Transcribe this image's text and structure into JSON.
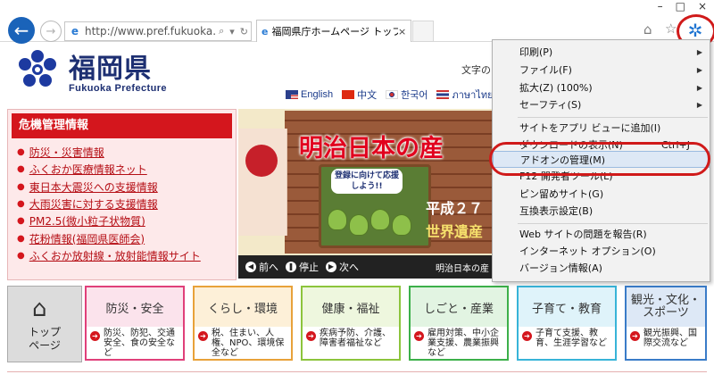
{
  "browser": {
    "address_url": "http://www.pref.fukuoka....",
    "tab_title": "福岡県庁ホームページ トップ...",
    "tab_close": "×"
  },
  "header": {
    "logo_text": "福岡県",
    "logo_subtitle": "Fukuoka Prefecture",
    "font_size_label": "文字の",
    "languages": [
      {
        "label": "English"
      },
      {
        "label": "中文"
      },
      {
        "label": "한국어"
      },
      {
        "label": "ภาษาไทย"
      }
    ]
  },
  "crisis": {
    "title": "危機管理情報",
    "links": [
      "防災・災害情報",
      "ふくおか医療情報ネット",
      "東日本大震災への支援情報",
      "大雨災害に対する支援情報",
      "PM2.5(微小粒子状物質)",
      "花粉情報(福岡県医師会)",
      "ふくおか放射線・放射能情報サイト"
    ]
  },
  "banner": {
    "title": "明治日本の産",
    "board_text": "登録に向けて応援しよう!!",
    "heisei_text": "平成２７",
    "isan_text": "世界遺産",
    "prev_label": "前へ",
    "stop_label": "停止",
    "next_label": "次へ",
    "caption": "明治日本の産"
  },
  "tiles": {
    "home": [
      "トップ",
      "ページ"
    ],
    "items": [
      {
        "title": "防災・安全",
        "desc": "防災、防犯、交通安全、食の安全など",
        "color": "#e0407a",
        "bg": "#fbe3ec"
      },
      {
        "title": "くらし・環境",
        "desc": "税、住まい、人権、NPO、環境保全など",
        "color": "#e8a23a",
        "bg": "#fdf0d8"
      },
      {
        "title": "健康・福祉",
        "desc": "疾病予防、介護、障害者福祉など",
        "color": "#8cc43c",
        "bg": "#eef7de"
      },
      {
        "title": "しごと・産業",
        "desc": "雇用対策、中小企業支援、農業振興など",
        "color": "#3cb04a",
        "bg": "#e2f4e2"
      },
      {
        "title": "子育て・教育",
        "desc": "子育て支援、教育、生涯学習など",
        "color": "#38b4d8",
        "bg": "#dff3fa"
      },
      {
        "title": "観光・文化・スポーツ",
        "desc": "観光振興、国際交流など",
        "color": "#3a7cc8",
        "bg": "#dde8f6"
      }
    ]
  },
  "menu": {
    "items": [
      {
        "label": "印刷(P)",
        "submenu": true
      },
      {
        "label": "ファイル(F)",
        "submenu": true
      },
      {
        "label": "拡大(Z) (100%)",
        "submenu": true
      },
      {
        "label": "セーフティ(S)",
        "submenu": true
      },
      {
        "label": "サイトをアプリ ビューに追加(I)"
      },
      {
        "label": "ダウンロードの表示(N)",
        "shortcut": "Ctrl+J"
      },
      {
        "label": "アドオンの管理(M)"
      },
      {
        "label": "F12 開発者ツール(L)"
      },
      {
        "label": "ピン留めサイト(G)"
      },
      {
        "label": "互換表示設定(B)"
      },
      {
        "label": "Web サイトの問題を報告(R)"
      },
      {
        "label": "インターネット オプション(O)"
      },
      {
        "label": "バージョン情報(A)"
      }
    ]
  },
  "colors": {
    "accent_red": "#d4161d",
    "ie_blue": "#1a63b9",
    "logo_navy": "#1d2f72"
  }
}
